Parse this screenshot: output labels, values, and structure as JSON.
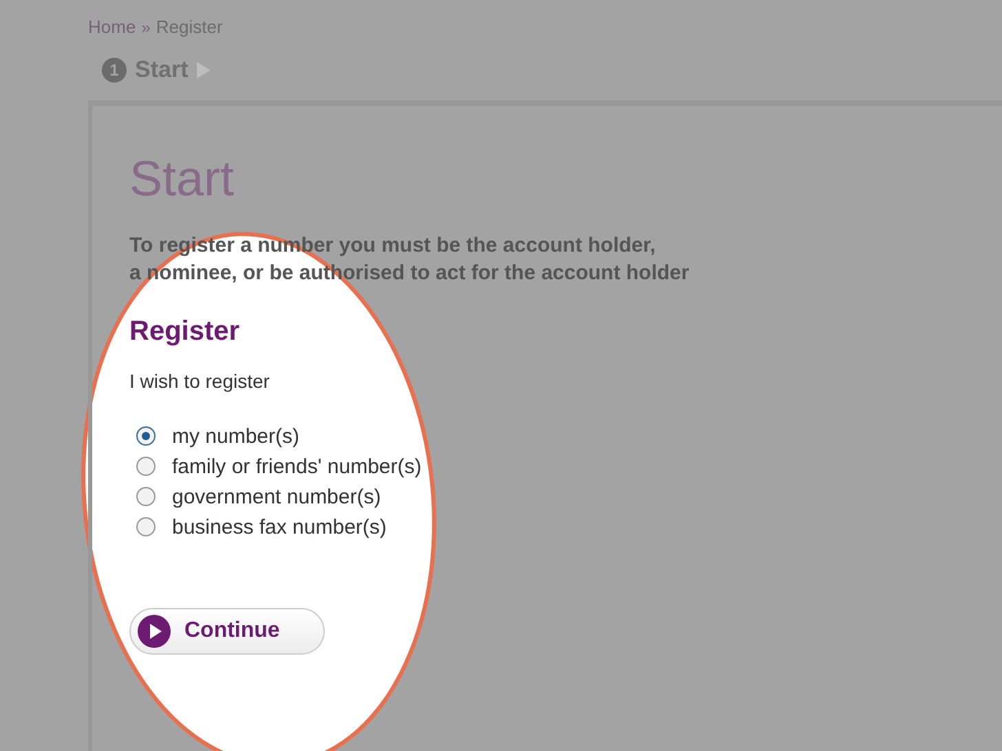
{
  "breadcrumb": {
    "items": [
      "Home",
      "Register"
    ],
    "separator": "»"
  },
  "steps": [
    {
      "number": "1",
      "label": "Start"
    }
  ],
  "page_title": "Start",
  "intro": "To register a number you must be the account holder,\na nominee, or be authorised to act for the account holder",
  "section_title": "Register",
  "prompt": "I wish to register",
  "options": [
    {
      "label": "my number(s)",
      "selected": true
    },
    {
      "label": "family or friends' number(s)",
      "selected": false
    },
    {
      "label": "government number(s)",
      "selected": false
    },
    {
      "label": "business fax number(s)",
      "selected": false
    }
  ],
  "button": {
    "label": "Continue"
  }
}
